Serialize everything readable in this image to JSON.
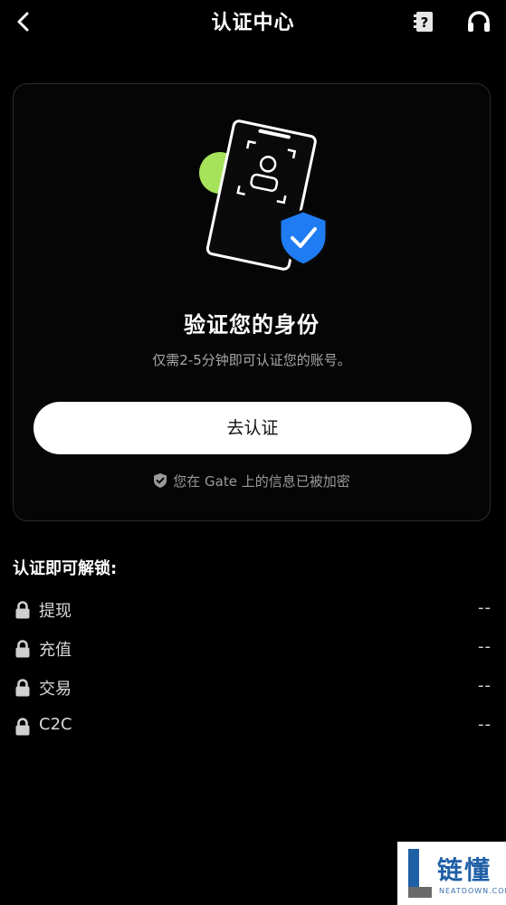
{
  "header": {
    "title": "认证中心",
    "back_icon": "chevron-left-icon",
    "faq_icon": "question-book-icon",
    "support_icon": "headset-icon"
  },
  "card": {
    "illustration": "id-card-verified-shield",
    "title": "验证您的身份",
    "subtitle": "仅需2-5分钟即可认证您的账号。",
    "button_label": "去认证",
    "secure_note": "您在 Gate 上的信息已被加密",
    "accent_green": "#a6e35a",
    "accent_blue": "#1f7cf2"
  },
  "unlock": {
    "title": "认证即可解锁:",
    "items": [
      {
        "label": "提现",
        "value": "--"
      },
      {
        "label": "充值",
        "value": "--"
      },
      {
        "label": "交易",
        "value": "--"
      },
      {
        "label": "C2C",
        "value": "--"
      }
    ]
  },
  "watermark": {
    "text": "链懂",
    "subtext": "NEATDOWN.COM"
  }
}
